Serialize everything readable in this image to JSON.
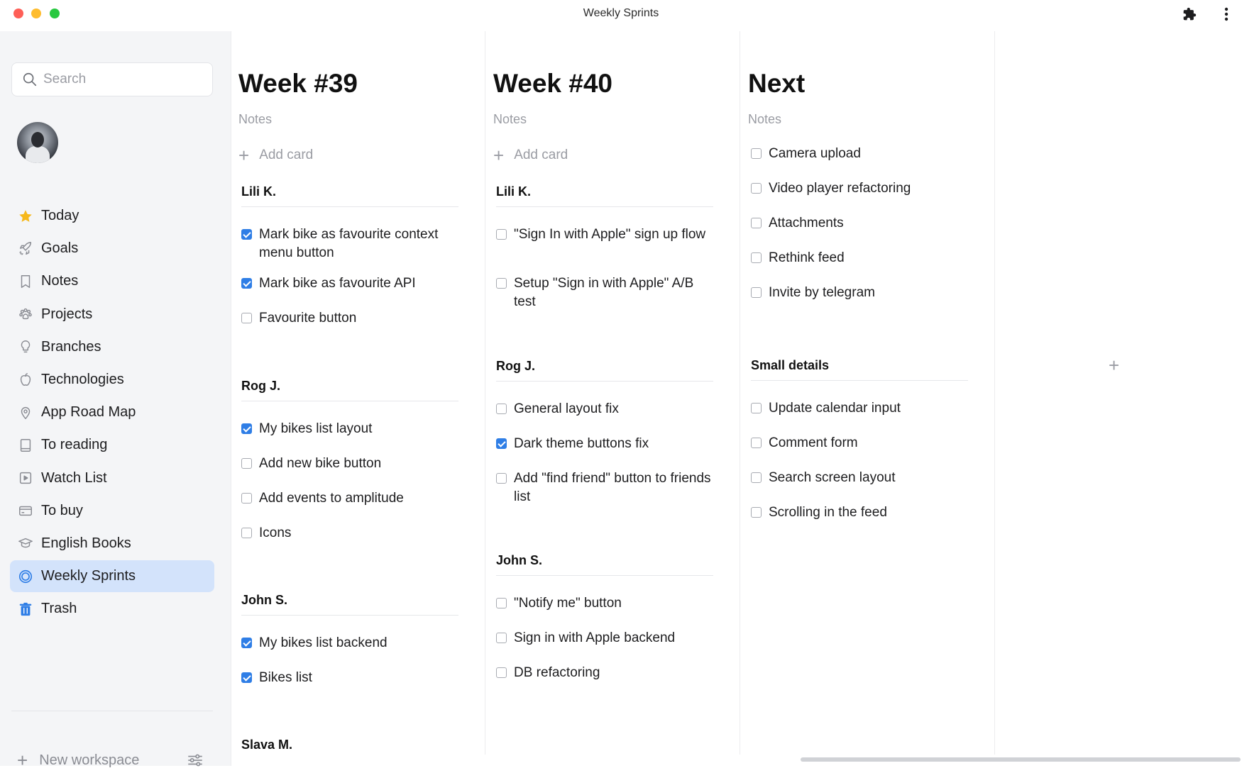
{
  "window": {
    "title": "Weekly Sprints"
  },
  "sidebar": {
    "search_placeholder": "Search",
    "items": [
      {
        "label": "Today",
        "icon": "star-icon"
      },
      {
        "label": "Goals",
        "icon": "rocket-icon"
      },
      {
        "label": "Notes",
        "icon": "bookmark-icon"
      },
      {
        "label": "Projects",
        "icon": "paw-icon"
      },
      {
        "label": "Branches",
        "icon": "lightbulb-icon"
      },
      {
        "label": "Technologies",
        "icon": "apple-icon"
      },
      {
        "label": "App Road Map",
        "icon": "map-pin-icon"
      },
      {
        "label": "To reading",
        "icon": "book-icon"
      },
      {
        "label": "Watch List",
        "icon": "play-icon"
      },
      {
        "label": "To buy",
        "icon": "card-icon"
      },
      {
        "label": "English Books",
        "icon": "graduation-cap-icon"
      },
      {
        "label": "Weekly Sprints",
        "icon": "circle-icon",
        "active": true
      },
      {
        "label": "Trash",
        "icon": "trash-icon"
      }
    ],
    "new_workspace_label": "New workspace"
  },
  "board": {
    "columns": [
      {
        "title": "Week #39",
        "notes_placeholder": "Notes",
        "add_card_label": "Add card",
        "groups": [
          {
            "name": "Lili K.",
            "tasks": [
              {
                "text": "Mark bike as favourite context menu button",
                "done": true
              },
              {
                "text": "Mark bike as favourite API",
                "done": true
              },
              {
                "text": "Favourite button",
                "done": false
              }
            ]
          },
          {
            "name": "Rog J.",
            "tasks": [
              {
                "text": "My bikes list layout",
                "done": true
              },
              {
                "text": "Add new bike button",
                "done": false
              },
              {
                "text": "Add events to amplitude",
                "done": false
              },
              {
                "text": "Icons",
                "done": false
              }
            ]
          },
          {
            "name": "John S.",
            "tasks": [
              {
                "text": "My bikes list backend",
                "done": true
              },
              {
                "text": "Bikes list",
                "done": true
              }
            ]
          },
          {
            "name": "Slava M.",
            "tasks": []
          }
        ]
      },
      {
        "title": "Week #40",
        "notes_placeholder": "Notes",
        "add_card_label": "Add card",
        "groups": [
          {
            "name": "Lili K.",
            "tasks": [
              {
                "text": "\"Sign In with Apple\" sign up flow",
                "done": false
              },
              {
                "text": "Setup \"Sign in with Apple\" A/B test",
                "done": false
              }
            ]
          },
          {
            "name": "Rog J.",
            "tasks": [
              {
                "text": "General layout fix",
                "done": false
              },
              {
                "text": "Dark theme buttons fix",
                "done": true
              },
              {
                "text": "Add \"find friend\" button to friends list",
                "done": false
              }
            ]
          },
          {
            "name": "John S.",
            "tasks": [
              {
                "text": "\"Notify me\" button",
                "done": false
              },
              {
                "text": "Sign in with Apple backend",
                "done": false
              },
              {
                "text": "DB refactoring",
                "done": false
              }
            ]
          }
        ]
      },
      {
        "title": "Next",
        "notes_placeholder": "Notes",
        "tasks": [
          {
            "text": "Camera upload",
            "done": false
          },
          {
            "text": "Video player refactoring",
            "done": false
          },
          {
            "text": "Attachments",
            "done": false
          },
          {
            "text": "Rethink feed",
            "done": false
          },
          {
            "text": "Invite by telegram",
            "done": false
          }
        ],
        "groups": [
          {
            "name": "Small details",
            "tasks": [
              {
                "text": "Update calendar input",
                "done": false
              },
              {
                "text": "Comment form",
                "done": false
              },
              {
                "text": "Search screen layout",
                "done": false
              },
              {
                "text": "Scrolling in the feed",
                "done": false
              }
            ]
          }
        ]
      }
    ]
  },
  "colors": {
    "accent": "#2f7ee6",
    "active_nav_bg": "#d3e3fb",
    "sidebar_bg": "#f4f5f7"
  }
}
